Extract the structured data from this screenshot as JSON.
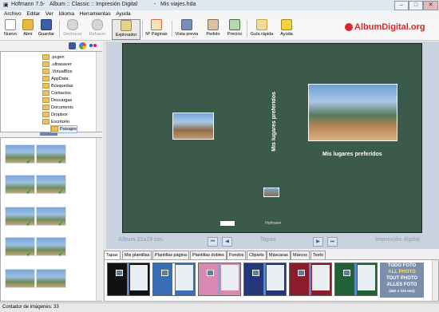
{
  "window": {
    "app": "Hofmann 7.5",
    "sep1": "-",
    "doc": "Album :: Classic :: Impresión Digital",
    "sep2": "-",
    "file": "Mis viajes.hda",
    "btn_min": "–",
    "btn_max": "□",
    "btn_close": "✕"
  },
  "menu": [
    "Archivo",
    "Editar",
    "Ver",
    "Idioma",
    "Herramientas",
    "Ayuda"
  ],
  "toolbar": {
    "nuevo": "Nuevo",
    "abrir": "Abrir",
    "guardar": "Guardar",
    "deshacer": "Deshacer",
    "rehacer": "Rehacer",
    "explorador": "Explorador",
    "paginas": "Nº Páginas",
    "vista": "Vista previa",
    "pedido": "Pedido",
    "precios": "Precios",
    "guia": "Guía rápida",
    "ayuda": "Ayuda",
    "brand": "AlbumDigital.org",
    "colors": {
      "nuevo": "#ffffff",
      "abrir": "#e7b845",
      "guardar": "#3d5fa8",
      "undo": "#b0b0b0",
      "explorador": "#e6d28a",
      "paginas": "#d66a3c",
      "vista": "#7a8fb5",
      "pedido": "#8a6d4a",
      "precios": "#3a7a3a",
      "guia": "#c9a33a",
      "ayuda": "#f2d23c",
      "brand": "#d9262b"
    }
  },
  "tree": [
    {
      "label": ".pcgen"
    },
    {
      "label": ".ultrasaver"
    },
    {
      "label": ".VirtualBox"
    },
    {
      "label": "AppData"
    },
    {
      "label": "Búsquedas"
    },
    {
      "label": "Contactos"
    },
    {
      "label": "Descargas"
    },
    {
      "label": "Documents"
    },
    {
      "label": "Dropbox"
    },
    {
      "label": "Escritorio"
    },
    {
      "label": "Paisajes"
    }
  ],
  "thumbs": [
    {
      "checked": true
    },
    {
      "checked": true
    },
    {
      "checked": true
    },
    {
      "checked": true
    },
    {
      "checked": true
    },
    {
      "checked": true
    },
    {
      "checked": true
    },
    {
      "checked": true
    },
    {
      "checked": true
    },
    {
      "checked": true
    },
    {
      "checked": false
    },
    {
      "checked": false
    }
  ],
  "canvas": {
    "vertical_title": "Mis lugares preferidos",
    "right_title": "Mis lugares preferidos",
    "logo": "Hofmann"
  },
  "spread": {
    "left_label": "Album 21x29 cm.",
    "center_label": "Tapas",
    "right_label": "Impresión digital"
  },
  "tabs": [
    "Tapas",
    "Mis plantillas",
    "Plantillas página",
    "Plantillas dobles",
    "Fondos",
    "Cliparts",
    "Máscaras",
    "Marcos",
    "Texto"
  ],
  "templates": [
    {
      "color": "#111111",
      "band": "#5b86c9"
    },
    {
      "color": "#3a6fb6",
      "band": "#ffffff"
    },
    {
      "color": "#d889b1",
      "band": "#7aa7d8"
    },
    {
      "color": "#24367a",
      "band": "#5b86c9"
    },
    {
      "color": "#8b1c2c",
      "band": "#5b86c9"
    },
    {
      "color": "#206235",
      "band": "#5b86c9"
    }
  ],
  "promo": [
    "TODO FOTO",
    "ALL PHOTO",
    "TOUT PHOTO",
    "ALLES FOTO",
    "(482 x 316 mm)"
  ],
  "status": "Contador de imágenes: 33"
}
